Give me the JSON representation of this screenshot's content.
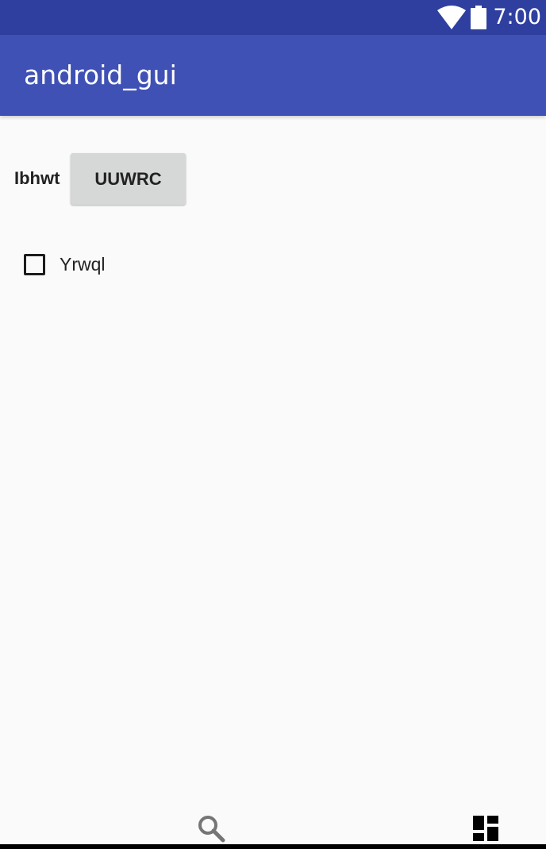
{
  "status_bar": {
    "time": "7:00",
    "icons": [
      "wifi-icon",
      "battery-icon"
    ]
  },
  "app_bar": {
    "title": "android_gui"
  },
  "form": {
    "label": "Ibhwt",
    "button_label": "UUWRC",
    "checkbox": {
      "label": "Yrwql",
      "checked": false
    }
  },
  "bottom_bar": {
    "icons": [
      "search-icon",
      "grid-icon"
    ]
  },
  "colors": {
    "status_bar": "#2f3f9f",
    "app_bar": "#3f51b5",
    "background": "#fafafa",
    "button": "#d6d7d7"
  }
}
